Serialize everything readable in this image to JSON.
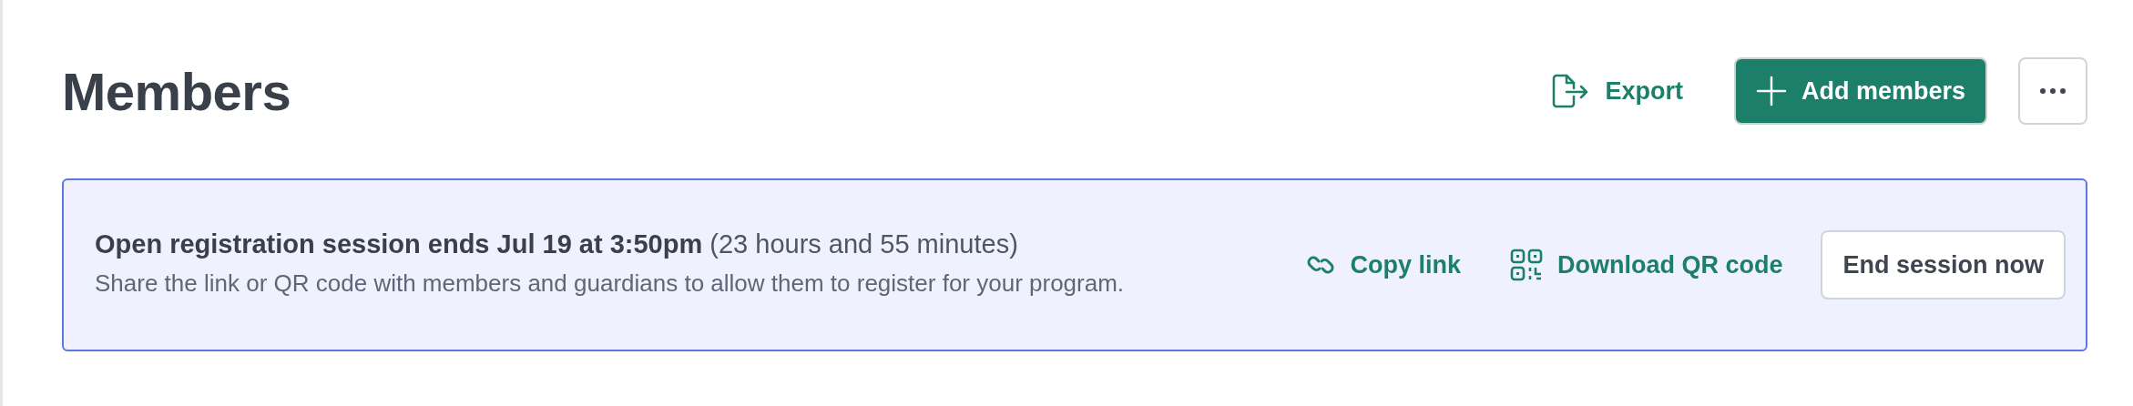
{
  "page": {
    "title": "Members"
  },
  "actions": [
    {
      "kind": "link",
      "label": "Export"
    },
    {
      "kind": "primary",
      "label": "Add members"
    },
    {
      "kind": "more"
    }
  ],
  "banner": {
    "heading": "Open registration session ends Jul 19 at 3:50pm",
    "remaining": "(23 hours and 55 minutes)",
    "description": "Share the link or QR code with members and guardians to allow them to register for your program.",
    "actions": [
      {
        "kind": "link",
        "label": "Copy link"
      },
      {
        "kind": "link",
        "label": "Download QR code"
      },
      {
        "kind": "secondary",
        "label": "End session now"
      }
    ]
  }
}
